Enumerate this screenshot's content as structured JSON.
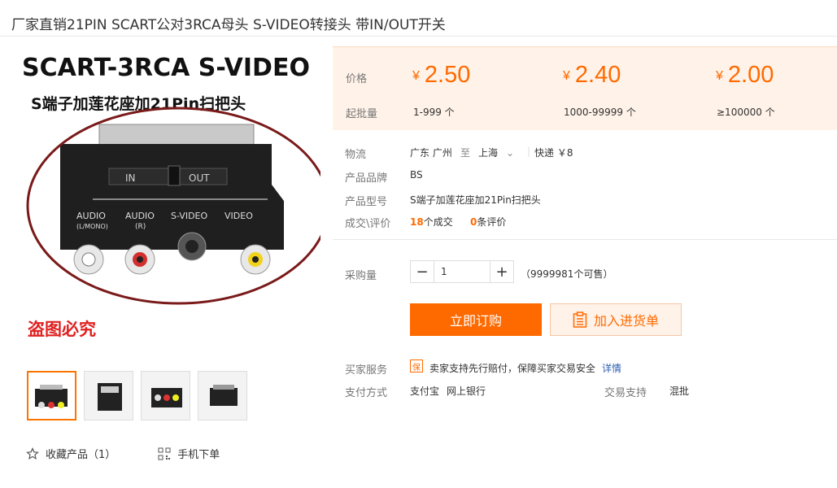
{
  "product": {
    "title": "厂家直销21PIN SCART公对3RCA母头 S-VIDEO转接头 带IN/OUT开关"
  },
  "image": {
    "headline": "SCART-3RCA S-VIDEO",
    "subheadline": "S端子加莲花座加21Pin扫把头",
    "switch_in": "IN",
    "switch_out": "OUT",
    "port_audio_l": "AUDIO",
    "port_audio_l_sub": "(L/MONO)",
    "port_audio_r": "AUDIO",
    "port_audio_r_sub": "(R)",
    "port_svideo": "S-VIDEO",
    "port_video": "VIDEO",
    "watermark": "盗图必究"
  },
  "price_panel": {
    "price_label": "价格",
    "batch_label": "起批量",
    "currency": "¥",
    "tiers": [
      {
        "price": "2.50",
        "batch": "1-999 个"
      },
      {
        "price": "2.40",
        "batch": "1000-99999 个"
      },
      {
        "price": "2.00",
        "batch": "≥100000 个"
      }
    ]
  },
  "info": {
    "logistics_label": "物流",
    "from": "广东 广州",
    "to_word": "至",
    "to": "上海",
    "shipping": "快递 ￥8",
    "brand_label": "产品品牌",
    "brand": "BS",
    "model_label": "产品型号",
    "model": "S端子加莲花座加21Pin扫把头",
    "deals_label": "成交\\评价",
    "deals_count": "18",
    "deals_text": "个成交",
    "reviews_count": "0",
    "reviews_text": "条评价"
  },
  "purchase": {
    "qty_label": "采购量",
    "qty": "1",
    "minus": "−",
    "plus": "+",
    "stock": "（9999981个可售）",
    "buy_label": "立即订购",
    "cart_label": "加入进货单"
  },
  "service": {
    "buyer_label": "买家服务",
    "badge": "保",
    "buyer_text": "卖家支持先行赔付，保障买家交易安全",
    "detail_link": "详情",
    "pay_label": "支付方式",
    "pay_alipay": "支付宝",
    "pay_bank": "网上银行",
    "trade_label": "交易支持",
    "trade_value": "混批"
  },
  "footer": {
    "favorite": "收藏产品（1）",
    "mobile_order": "手机下单"
  },
  "colors": {
    "accent": "#ff6a00",
    "panel_bg": "#fff2e8",
    "link": "#2a5db0"
  }
}
